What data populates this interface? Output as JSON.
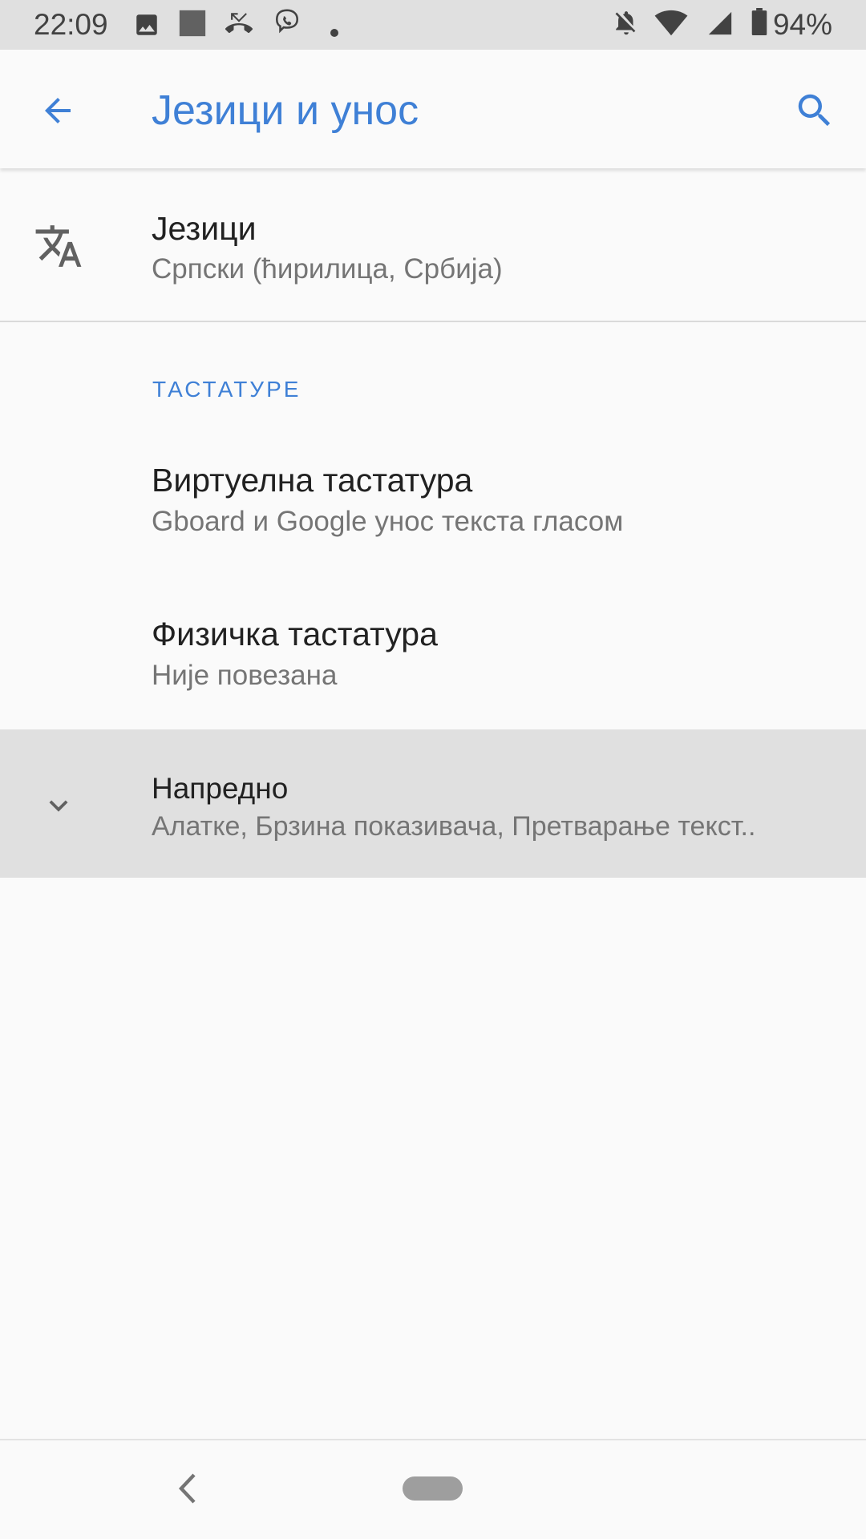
{
  "status_bar": {
    "time": "22:09",
    "battery_percent": "94%",
    "icons": [
      "image-icon",
      "square-icon",
      "missed-call-icon",
      "viber-icon",
      "dot-icon",
      "notifications-off-icon",
      "wifi-icon",
      "signal-icon",
      "battery-icon"
    ]
  },
  "app_bar": {
    "title": "Језици и унос",
    "back_icon": "arrow-back-icon",
    "search_icon": "search-icon"
  },
  "items": {
    "languages": {
      "title": "Језици",
      "subtitle": "Српски (ћирилица, Србија)",
      "icon": "translate-icon"
    },
    "keyboards_header": "ТАСТАТУРЕ",
    "virtual_keyboard": {
      "title": "Виртуелна тастатура",
      "subtitle": "Gboard и Google унос текста гласом"
    },
    "physical_keyboard": {
      "title": "Физичка тастатура",
      "subtitle": "Није повезана"
    },
    "advanced": {
      "title": "Напредно",
      "subtitle": "Алатке, Брзина показивача, Претварање текст..",
      "icon": "chevron-down-icon"
    }
  },
  "nav_bar": {
    "back_icon": "nav-back-icon",
    "home_icon": "nav-home-pill"
  },
  "colors": {
    "accent": "#3F80D6",
    "background": "#FAFAFA",
    "status_bar": "#E0E0E0",
    "highlight_row": "#E0E0E0"
  }
}
